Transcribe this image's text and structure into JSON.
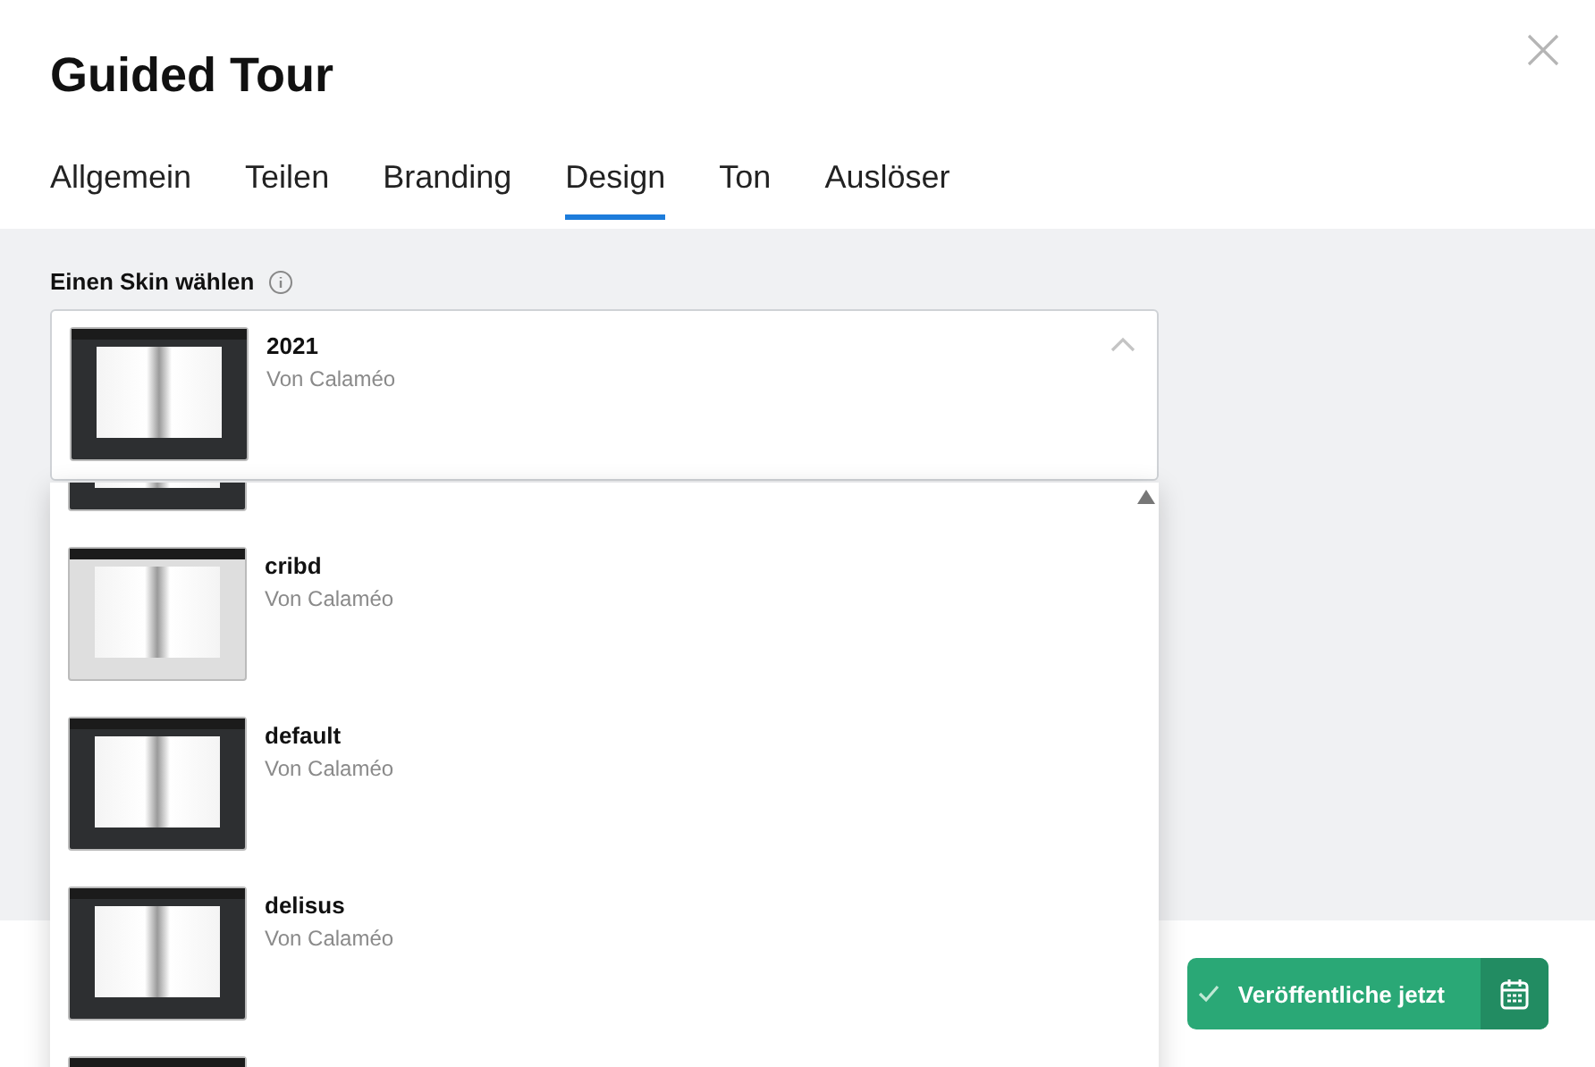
{
  "dialog": {
    "title": "Guided Tour"
  },
  "tabs": [
    {
      "label": "Allgemein",
      "selected": false
    },
    {
      "label": "Teilen",
      "selected": false
    },
    {
      "label": "Branding",
      "selected": false
    },
    {
      "label": "Design",
      "selected": true
    },
    {
      "label": "Ton",
      "selected": false
    },
    {
      "label": "Auslöser",
      "selected": false
    }
  ],
  "skin_field": {
    "label": "Einen Skin wählen",
    "expanded": true,
    "value": {
      "name": "2021",
      "author": "Von Calaméo",
      "kind": "dark"
    }
  },
  "skin_options": [
    {
      "kind": "dark"
    },
    {
      "name": "cribd",
      "author": "Von Calaméo",
      "kind": "light"
    },
    {
      "name": "default",
      "author": "Von Calaméo",
      "kind": "dark"
    },
    {
      "name": "delisus",
      "author": "Von Calaméo",
      "kind": "dark"
    },
    {
      "kind": "dark"
    }
  ],
  "publish_button": {
    "label": "Veröffentliche jetzt"
  }
}
